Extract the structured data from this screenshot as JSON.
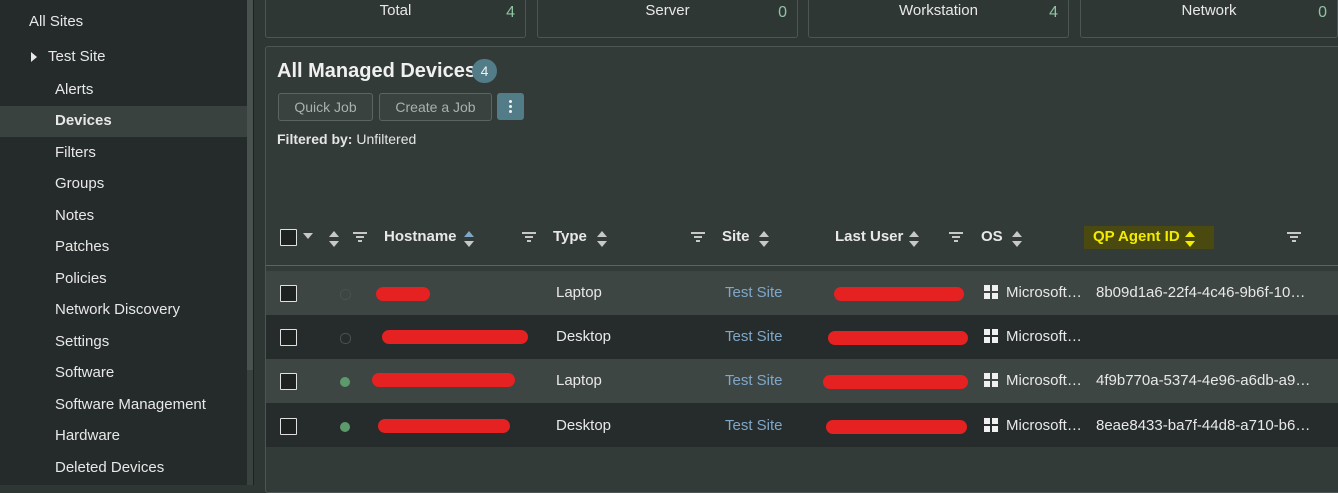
{
  "sidebar": {
    "all_sites": "All Sites",
    "test_site": "Test Site",
    "items": [
      "Alerts",
      "Devices",
      "Filters",
      "Groups",
      "Notes",
      "Patches",
      "Policies",
      "Network Discovery",
      "Settings",
      "Software",
      "Software Management",
      "Hardware",
      "Deleted Devices"
    ],
    "active": "Devices"
  },
  "summary": [
    {
      "label": "Total",
      "count": "4"
    },
    {
      "label": "Server",
      "count": "0"
    },
    {
      "label": "Workstation",
      "count": "4"
    },
    {
      "label": "Network",
      "count": "0"
    }
  ],
  "panel": {
    "title": "All Managed Devices",
    "count": "4",
    "quick_job": "Quick Job",
    "create_job": "Create a Job",
    "filtered_label": "Filtered by:",
    "filtered_value": "Unfiltered"
  },
  "columns": {
    "hostname": "Hostname",
    "type": "Type",
    "site": "Site",
    "last_user": "Last User",
    "os": "OS",
    "qp_agent_id": "QP Agent ID"
  },
  "rows": [
    {
      "type": "Laptop",
      "site": "Test Site",
      "os": "Microsoft…",
      "agent_id": "8b09d1a6-22f4-4c46-9b6f-10…",
      "online": false
    },
    {
      "type": "Desktop",
      "site": "Test Site",
      "os": "Microsoft…",
      "agent_id": "",
      "online": false
    },
    {
      "type": "Laptop",
      "site": "Test Site",
      "os": "Microsoft…",
      "agent_id": "4f9b770a-5374-4e96-a6db-a9…",
      "online": true
    },
    {
      "type": "Desktop",
      "site": "Test Site",
      "os": "Microsoft…",
      "agent_id": "8eae8433-ba7f-44d8-a710-b6…",
      "online": true
    }
  ],
  "colors": {
    "accent": "#527c88",
    "online": "#5c9a6c",
    "site_link": "#7fa7c8",
    "qp_highlight": "#f2ec00"
  }
}
